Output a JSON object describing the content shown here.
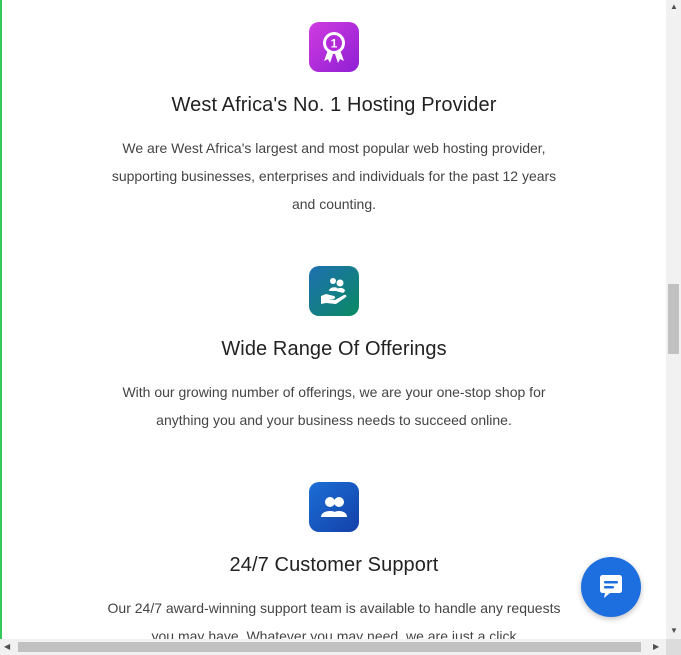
{
  "features": [
    {
      "icon": "award-ribbon-icon",
      "badge_number": "1",
      "title": "West Africa's No. 1 Hosting Provider",
      "description": "We are West Africa's largest and most popular web hosting provider, supporting businesses, enterprises and individuals for the past 12 years and counting."
    },
    {
      "icon": "helping-hand-icon",
      "title": "Wide Range Of Offerings",
      "description": "With our growing number of offerings, we are your one-stop shop for anything you and your business needs to succeed online."
    },
    {
      "icon": "users-icon",
      "title": "24/7 Customer Support",
      "description": "Our 24/7 award-winning support team is available to handle any requests you may have. Whatever you may need, we are just a click"
    }
  ],
  "chat_widget": {
    "icon": "chat-bubble-icon",
    "color": "#1d6fe0"
  },
  "colors": {
    "icon1_gradient": [
      "#d03be0",
      "#8f1fd4"
    ],
    "icon2_gradient": [
      "#1f6fb2",
      "#0a8a62"
    ],
    "icon3_gradient": [
      "#1b6fd6",
      "#1340a8"
    ]
  }
}
